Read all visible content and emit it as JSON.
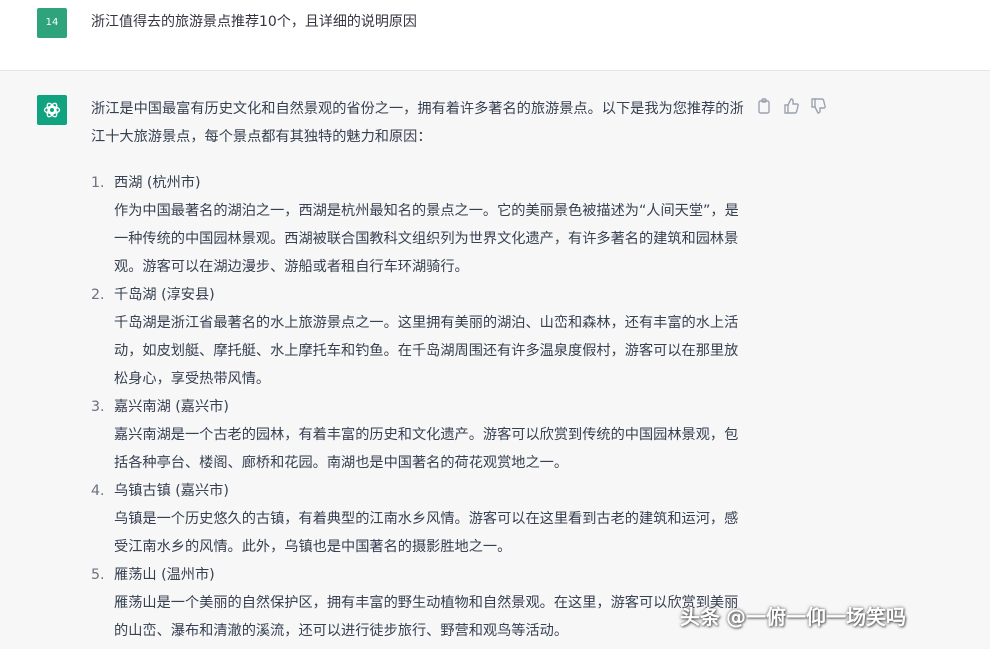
{
  "user_message": {
    "avatar_text": "14",
    "text": "浙江值得去的旅游景点推荐10个，且详细的说明原因"
  },
  "assistant_message": {
    "icons": [
      "openai-logo-icon",
      "copy-icon",
      "thumbs-up-icon",
      "thumbs-down-icon"
    ],
    "intro": "浙江是中国最富有历史文化和自然景观的省份之一，拥有着许多著名的旅游景点。以下是我为您推荐的浙江十大旅游景点，每个景点都有其独特的魅力和原因：",
    "spots": [
      {
        "number": "1.",
        "title": "西湖 (杭州市)",
        "desc": "作为中国最著名的湖泊之一，西湖是杭州最知名的景点之一。它的美丽景色被描述为“人间天堂”，是一种传统的中国园林景观。西湖被联合国教科文组织列为世界文化遗产，有许多著名的建筑和园林景观。游客可以在湖边漫步、游船或者租自行车环湖骑行。"
      },
      {
        "number": "2.",
        "title": "千岛湖 (淳安县)",
        "desc": "千岛湖是浙江省最著名的水上旅游景点之一。这里拥有美丽的湖泊、山峦和森林，还有丰富的水上活动，如皮划艇、摩托艇、水上摩托车和钓鱼。在千岛湖周围还有许多温泉度假村，游客可以在那里放松身心，享受热带风情。"
      },
      {
        "number": "3.",
        "title": "嘉兴南湖 (嘉兴市)",
        "desc": "嘉兴南湖是一个古老的园林，有着丰富的历史和文化遗产。游客可以欣赏到传统的中国园林景观，包括各种亭台、楼阁、廊桥和花园。南湖也是中国著名的荷花观赏地之一。"
      },
      {
        "number": "4.",
        "title": "乌镇古镇 (嘉兴市)",
        "desc": "乌镇是一个历史悠久的古镇，有着典型的江南水乡风情。游客可以在这里看到古老的建筑和运河，感受江南水乡的风情。此外，乌镇也是中国著名的摄影胜地之一。"
      },
      {
        "number": "5.",
        "title": "雁荡山 (温州市)",
        "desc": "雁荡山是一个美丽的自然保护区，拥有丰富的野生动植物和自然景观。在这里，游客可以欣赏到美丽的山峦、瀑布和清澈的溪流，还可以进行徒步旅行、野营和观鸟等活动。"
      }
    ]
  },
  "watermark": {
    "logo": "头条",
    "handle": "@一俯一仰一场笑吗"
  },
  "colors": {
    "user_avatar": "#2fa37c",
    "bot_avatar": "#10a37f",
    "assistant_bg": "#f7f7f8",
    "text": "#374151"
  }
}
